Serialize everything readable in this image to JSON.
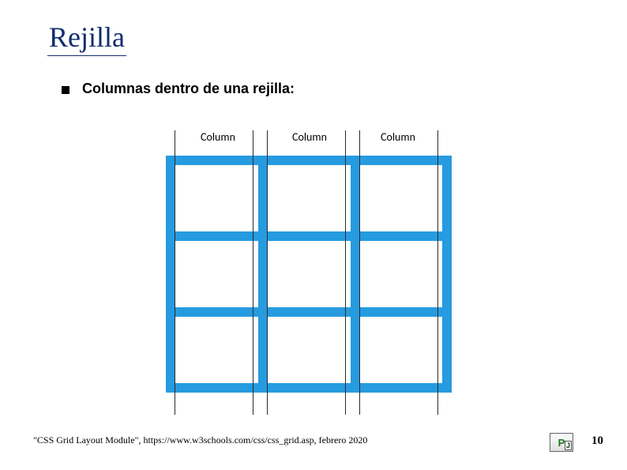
{
  "title": "Rejilla",
  "bullet": "Columnas dentro de una rejilla:",
  "diagram": {
    "column_label": "Column",
    "columns": 3,
    "rows": 3
  },
  "footer_cite": "\"CSS Grid Layout Module\", https://www.w3schools.com/css/css_grid.asp, febrero 2020",
  "page_number": "10",
  "logo_text": {
    "p": "P",
    "j": "J"
  }
}
